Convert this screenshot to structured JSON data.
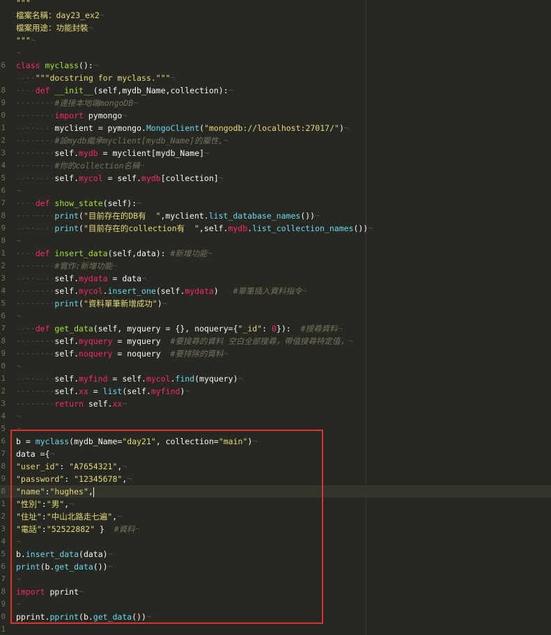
{
  "editor": {
    "theme_colors": {
      "background": "#272822",
      "keyword": "#f92672",
      "string": "#e6db74",
      "comment": "#75715e",
      "function": "#a6e22e",
      "builtin": "#66d9ef",
      "highlight_box": "#e03030"
    },
    "lines": [
      {
        "n": "",
        "tokens": [
          {
            "t": "\"\"\"",
            "c": "str"
          }
        ]
      },
      {
        "n": "",
        "tokens": [
          {
            "t": "檔案名稱：day23_ex2",
            "c": "str"
          },
          {
            "t": "¬",
            "c": "inv"
          }
        ]
      },
      {
        "n": "",
        "tokens": [
          {
            "t": "檔案用途：功能封裝",
            "c": "str"
          },
          {
            "t": "¬",
            "c": "inv"
          }
        ]
      },
      {
        "n": "",
        "tokens": [
          {
            "t": "\"\"\"",
            "c": "str"
          },
          {
            "t": "¬",
            "c": "inv"
          }
        ]
      },
      {
        "n": "",
        "tokens": [
          {
            "t": "¬",
            "c": "inv"
          }
        ]
      },
      {
        "n": "6",
        "tokens": [
          {
            "t": "class ",
            "c": "kw"
          },
          {
            "t": "myclass",
            "c": "cls"
          },
          {
            "t": "():",
            "c": ""
          },
          {
            "t": "¬",
            "c": "inv"
          }
        ]
      },
      {
        "n": "",
        "tokens": [
          {
            "t": "····",
            "c": "dot"
          },
          {
            "t": "\"\"\"docstring for myclass.\"\"\"",
            "c": "str"
          },
          {
            "t": "¬",
            "c": "inv"
          }
        ]
      },
      {
        "n": "8",
        "tokens": [
          {
            "t": "····",
            "c": "dot"
          },
          {
            "t": "def ",
            "c": "kw"
          },
          {
            "t": "__init__",
            "c": "fn"
          },
          {
            "t": "(self,mydb_Name,collection):",
            "c": ""
          },
          {
            "t": "¬",
            "c": "inv"
          }
        ]
      },
      {
        "n": "9",
        "tokens": [
          {
            "t": "········",
            "c": "dot"
          },
          {
            "t": "#連接本地端mongoDB",
            "c": "cm"
          },
          {
            "t": "¬",
            "c": "inv"
          }
        ]
      },
      {
        "n": "0",
        "tokens": [
          {
            "t": "········",
            "c": "dot"
          },
          {
            "t": "import ",
            "c": "kw"
          },
          {
            "t": "pymongo",
            "c": ""
          },
          {
            "t": "¬",
            "c": "inv"
          }
        ]
      },
      {
        "n": "1",
        "tokens": [
          {
            "t": "········",
            "c": "dot"
          },
          {
            "t": "myclient = pymongo.",
            "c": ""
          },
          {
            "t": "MongoClient",
            "c": "bi"
          },
          {
            "t": "(",
            "c": ""
          },
          {
            "t": "\"mongodb://localhost:27017/\"",
            "c": "str"
          },
          {
            "t": ")",
            "c": ""
          },
          {
            "t": "¬",
            "c": "inv"
          }
        ]
      },
      {
        "n": "2",
        "tokens": [
          {
            "t": "········",
            "c": "dot"
          },
          {
            "t": "#設mydb繼承myclient[mydb_Name]的屬性,",
            "c": "cm"
          },
          {
            "t": "¬",
            "c": "inv"
          }
        ]
      },
      {
        "n": "3",
        "tokens": [
          {
            "t": "········",
            "c": "dot"
          },
          {
            "t": "self.",
            "c": ""
          },
          {
            "t": "mydb",
            "c": "attr"
          },
          {
            "t": " = myclient[mydb_Name]",
            "c": ""
          },
          {
            "t": "¬",
            "c": "inv"
          }
        ]
      },
      {
        "n": "4",
        "tokens": [
          {
            "t": "········",
            "c": "dot"
          },
          {
            "t": "#你的collection名稱",
            "c": "cm"
          },
          {
            "t": "¬",
            "c": "inv"
          }
        ]
      },
      {
        "n": "5",
        "tokens": [
          {
            "t": "········",
            "c": "dot"
          },
          {
            "t": "self.",
            "c": ""
          },
          {
            "t": "mycol",
            "c": "attr"
          },
          {
            "t": " = self.",
            "c": ""
          },
          {
            "t": "mydb",
            "c": "attr"
          },
          {
            "t": "[collection]",
            "c": ""
          },
          {
            "t": "¬",
            "c": "inv"
          }
        ]
      },
      {
        "n": "6",
        "tokens": [
          {
            "t": "¬",
            "c": "inv"
          }
        ]
      },
      {
        "n": "7",
        "tokens": [
          {
            "t": "····",
            "c": "dot"
          },
          {
            "t": "def ",
            "c": "kw"
          },
          {
            "t": "show_state",
            "c": "fn"
          },
          {
            "t": "(self):",
            "c": ""
          },
          {
            "t": "¬",
            "c": "inv"
          }
        ]
      },
      {
        "n": "8",
        "tokens": [
          {
            "t": "········",
            "c": "dot"
          },
          {
            "t": "print",
            "c": "bi"
          },
          {
            "t": "(",
            "c": ""
          },
          {
            "t": "\"目前存在的DB有  \"",
            "c": "str"
          },
          {
            "t": ",myclient.",
            "c": ""
          },
          {
            "t": "list_database_names",
            "c": "bi"
          },
          {
            "t": "())",
            "c": ""
          },
          {
            "t": "¬",
            "c": "inv"
          }
        ]
      },
      {
        "n": "9",
        "tokens": [
          {
            "t": "········",
            "c": "dot"
          },
          {
            "t": "print",
            "c": "bi"
          },
          {
            "t": "(",
            "c": ""
          },
          {
            "t": "\"目前存在的collection有  \"",
            "c": "str"
          },
          {
            "t": ",self.",
            "c": ""
          },
          {
            "t": "mydb",
            "c": "attr"
          },
          {
            "t": ".",
            "c": ""
          },
          {
            "t": "list_collection_names",
            "c": "bi"
          },
          {
            "t": "())",
            "c": ""
          },
          {
            "t": "¬",
            "c": "inv"
          }
        ]
      },
      {
        "n": "0",
        "tokens": [
          {
            "t": "¬",
            "c": "inv"
          }
        ]
      },
      {
        "n": "1",
        "tokens": [
          {
            "t": "····",
            "c": "dot"
          },
          {
            "t": "def ",
            "c": "kw"
          },
          {
            "t": "insert_data",
            "c": "fn"
          },
          {
            "t": "(self,data): ",
            "c": ""
          },
          {
            "t": "#新增功能",
            "c": "cm"
          },
          {
            "t": "¬",
            "c": "inv"
          }
        ]
      },
      {
        "n": "2",
        "tokens": [
          {
            "t": "········",
            "c": "dot"
          },
          {
            "t": "#實作:新增功能",
            "c": "cm"
          },
          {
            "t": "¬",
            "c": "inv"
          }
        ]
      },
      {
        "n": "3",
        "tokens": [
          {
            "t": "········",
            "c": "dot"
          },
          {
            "t": "self.",
            "c": ""
          },
          {
            "t": "mydata",
            "c": "attr"
          },
          {
            "t": " = data",
            "c": ""
          },
          {
            "t": "¬",
            "c": "inv"
          }
        ]
      },
      {
        "n": "4",
        "tokens": [
          {
            "t": "········",
            "c": "dot"
          },
          {
            "t": "self.",
            "c": ""
          },
          {
            "t": "mycol",
            "c": "attr"
          },
          {
            "t": ".",
            "c": ""
          },
          {
            "t": "insert_one",
            "c": "bi"
          },
          {
            "t": "(self.",
            "c": ""
          },
          {
            "t": "mydata",
            "c": "attr"
          },
          {
            "t": ")   ",
            "c": ""
          },
          {
            "t": "#單筆插入資料指令",
            "c": "cm"
          },
          {
            "t": "¬",
            "c": "inv"
          }
        ]
      },
      {
        "n": "5",
        "tokens": [
          {
            "t": "········",
            "c": "dot"
          },
          {
            "t": "print",
            "c": "bi"
          },
          {
            "t": "(",
            "c": ""
          },
          {
            "t": "\"資料單筆新增成功\"",
            "c": "str"
          },
          {
            "t": ")",
            "c": ""
          },
          {
            "t": "¬",
            "c": "inv"
          }
        ]
      },
      {
        "n": "6",
        "tokens": [
          {
            "t": "¬",
            "c": "inv"
          }
        ]
      },
      {
        "n": "7",
        "tokens": [
          {
            "t": "····",
            "c": "dot"
          },
          {
            "t": "def ",
            "c": "kw"
          },
          {
            "t": "get_data",
            "c": "fn"
          },
          {
            "t": "(self, myquery = {}, noquery={",
            "c": ""
          },
          {
            "t": "\"_id\"",
            "c": "str"
          },
          {
            "t": ": ",
            "c": ""
          },
          {
            "t": "0",
            "c": "kw"
          },
          {
            "t": "}):  ",
            "c": ""
          },
          {
            "t": "#搜尋資料",
            "c": "cm"
          },
          {
            "t": "¬",
            "c": "inv"
          }
        ]
      },
      {
        "n": "8",
        "tokens": [
          {
            "t": "········",
            "c": "dot"
          },
          {
            "t": "self.",
            "c": ""
          },
          {
            "t": "myquery",
            "c": "attr"
          },
          {
            "t": " = myquery  ",
            "c": ""
          },
          {
            "t": "#要搜尋的資料 空白全部搜尋，帶值搜尋特定值，",
            "c": "cm"
          },
          {
            "t": "¬",
            "c": "inv"
          }
        ]
      },
      {
        "n": "9",
        "tokens": [
          {
            "t": "········",
            "c": "dot"
          },
          {
            "t": "self.",
            "c": ""
          },
          {
            "t": "noquery",
            "c": "attr"
          },
          {
            "t": " = noquery  ",
            "c": ""
          },
          {
            "t": "#要排除的資料",
            "c": "cm"
          },
          {
            "t": "¬",
            "c": "inv"
          }
        ]
      },
      {
        "n": "0",
        "tokens": [
          {
            "t": "¬",
            "c": "inv"
          }
        ]
      },
      {
        "n": "1",
        "tokens": [
          {
            "t": "········",
            "c": "dot"
          },
          {
            "t": "self.",
            "c": ""
          },
          {
            "t": "myfind",
            "c": "attr"
          },
          {
            "t": " = self.",
            "c": ""
          },
          {
            "t": "mycol",
            "c": "attr"
          },
          {
            "t": ".",
            "c": ""
          },
          {
            "t": "find",
            "c": "bi"
          },
          {
            "t": "(myquery)",
            "c": ""
          },
          {
            "t": "¬",
            "c": "inv"
          }
        ]
      },
      {
        "n": "2",
        "tokens": [
          {
            "t": "········",
            "c": "dot"
          },
          {
            "t": "self.",
            "c": ""
          },
          {
            "t": "xx",
            "c": "attr"
          },
          {
            "t": " = ",
            "c": ""
          },
          {
            "t": "list",
            "c": "bi"
          },
          {
            "t": "(self.",
            "c": ""
          },
          {
            "t": "myfind",
            "c": "attr"
          },
          {
            "t": ")",
            "c": ""
          },
          {
            "t": "¬",
            "c": "inv"
          }
        ]
      },
      {
        "n": "3",
        "tokens": [
          {
            "t": "········",
            "c": "dot"
          },
          {
            "t": "return ",
            "c": "kw"
          },
          {
            "t": "self.",
            "c": ""
          },
          {
            "t": "xx",
            "c": "attr"
          },
          {
            "t": "¬",
            "c": "inv"
          }
        ]
      },
      {
        "n": "4",
        "tokens": [
          {
            "t": "¬",
            "c": "inv"
          }
        ]
      },
      {
        "n": "5",
        "tokens": [
          {
            "t": "¬",
            "c": "inv"
          }
        ]
      },
      {
        "n": "6",
        "tokens": [
          {
            "t": "b = ",
            "c": ""
          },
          {
            "t": "myclass",
            "c": "bi"
          },
          {
            "t": "(mydb_Name=",
            "c": ""
          },
          {
            "t": "\"day21\"",
            "c": "str"
          },
          {
            "t": ", collection=",
            "c": ""
          },
          {
            "t": "\"main\"",
            "c": "str"
          },
          {
            "t": ")",
            "c": ""
          },
          {
            "t": "¬",
            "c": "inv"
          }
        ]
      },
      {
        "n": "7",
        "tokens": [
          {
            "t": "data ={",
            "c": ""
          },
          {
            "t": "¬",
            "c": "inv"
          }
        ]
      },
      {
        "n": "8",
        "tokens": [
          {
            "t": "\"user_id\"",
            "c": "str"
          },
          {
            "t": ": ",
            "c": ""
          },
          {
            "t": "\"A7654321\"",
            "c": "str"
          },
          {
            "t": ",",
            "c": ""
          },
          {
            "t": "¬",
            "c": "inv"
          }
        ]
      },
      {
        "n": "9",
        "tokens": [
          {
            "t": "\"password\"",
            "c": "str"
          },
          {
            "t": ": ",
            "c": ""
          },
          {
            "t": "\"12345678\"",
            "c": "str"
          },
          {
            "t": ",",
            "c": ""
          },
          {
            "t": "¬",
            "c": "inv"
          }
        ]
      },
      {
        "n": "0",
        "active": true,
        "caret": true,
        "tokens": [
          {
            "t": "\"name\"",
            "c": "str"
          },
          {
            "t": ":",
            "c": ""
          },
          {
            "t": "\"hughes\"",
            "c": "str"
          },
          {
            "t": ",",
            "c": ""
          }
        ]
      },
      {
        "n": "1",
        "tokens": [
          {
            "t": "\"性別\"",
            "c": "str"
          },
          {
            "t": ":",
            "c": ""
          },
          {
            "t": "\"男\"",
            "c": "str"
          },
          {
            "t": ",",
            "c": ""
          },
          {
            "t": "¬",
            "c": "inv"
          }
        ]
      },
      {
        "n": "2",
        "tokens": [
          {
            "t": "\"住址\"",
            "c": "str"
          },
          {
            "t": ":",
            "c": ""
          },
          {
            "t": "\"中山北路走七遍\"",
            "c": "str"
          },
          {
            "t": ",",
            "c": ""
          },
          {
            "t": "¬",
            "c": "inv"
          }
        ]
      },
      {
        "n": "3",
        "tokens": [
          {
            "t": "\"電話\"",
            "c": "str"
          },
          {
            "t": ":",
            "c": ""
          },
          {
            "t": "\"52522882\"",
            "c": "str"
          },
          {
            "t": " }  ",
            "c": ""
          },
          {
            "t": "#資料",
            "c": "cm"
          },
          {
            "t": "¬",
            "c": "inv"
          }
        ]
      },
      {
        "n": "4",
        "tokens": [
          {
            "t": "¬",
            "c": "inv"
          }
        ]
      },
      {
        "n": "5",
        "tokens": [
          {
            "t": "b.",
            "c": ""
          },
          {
            "t": "insert_data",
            "c": "bi"
          },
          {
            "t": "(data)",
            "c": ""
          },
          {
            "t": "¬",
            "c": "inv"
          }
        ]
      },
      {
        "n": "6",
        "tokens": [
          {
            "t": "print",
            "c": "bi"
          },
          {
            "t": "(b.",
            "c": ""
          },
          {
            "t": "get_data",
            "c": "bi"
          },
          {
            "t": "())",
            "c": ""
          },
          {
            "t": "¬",
            "c": "inv"
          }
        ]
      },
      {
        "n": "7",
        "tokens": [
          {
            "t": "¬",
            "c": "inv"
          }
        ]
      },
      {
        "n": "8",
        "tokens": [
          {
            "t": "import ",
            "c": "kw"
          },
          {
            "t": "pprint",
            "c": ""
          },
          {
            "t": "¬",
            "c": "inv"
          }
        ]
      },
      {
        "n": "9",
        "tokens": [
          {
            "t": "¬",
            "c": "inv"
          }
        ]
      },
      {
        "n": "0",
        "tokens": [
          {
            "t": "pprint.",
            "c": ""
          },
          {
            "t": "pprint",
            "c": "bi"
          },
          {
            "t": "(b.",
            "c": ""
          },
          {
            "t": "get_data",
            "c": "bi"
          },
          {
            "t": "())",
            "c": ""
          },
          {
            "t": "¬",
            "c": "inv"
          }
        ]
      },
      {
        "n": "1",
        "tokens": []
      }
    ]
  }
}
